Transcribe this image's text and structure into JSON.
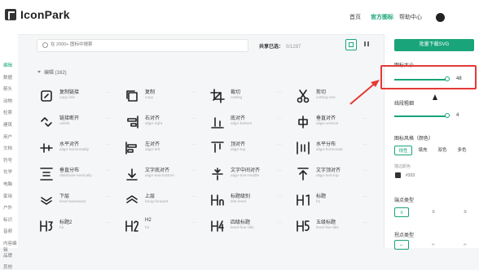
{
  "header": {
    "logo_text": "IconPark",
    "nav": [
      "首页",
      "官方图标",
      "帮助中心"
    ],
    "active_nav": "官方图标",
    "accent": "#19a47a"
  },
  "left_nav": {
    "items": [
      "编辑",
      "数据",
      "箭头",
      "动物",
      "检索",
      "建筑",
      "用户",
      "文档",
      "符号",
      "化学",
      "电脑",
      "家用",
      "户外",
      "标识",
      "音频",
      "内容编辑",
      "品牌",
      "其他"
    ],
    "active": "编辑"
  },
  "toolbar": {
    "search_placeholder": "在 2000+ 图标中搜索",
    "share_label": "共享已选：",
    "share_count": "0/1287"
  },
  "section": {
    "title": "编辑 (162)"
  },
  "icons": [
    {
      "name": "复制链接",
      "en": "copy-link",
      "icon": "copy-link-icon"
    },
    {
      "name": "复制",
      "en": "copy",
      "icon": "copy-icon"
    },
    {
      "name": "裁切",
      "en": "cutting",
      "icon": "crop-icon"
    },
    {
      "name": "剪切",
      "en": "cutting-one",
      "icon": "scissors-icon"
    },
    {
      "name": "链接断开",
      "en": "unlink",
      "icon": "unlink-icon"
    },
    {
      "name": "右对齐",
      "en": "align-right",
      "icon": "align-right-icon"
    },
    {
      "name": "底对齐",
      "en": "align-bottom",
      "icon": "align-bottom-icon"
    },
    {
      "name": "垂直对齐",
      "en": "align-vertical",
      "icon": "align-vertical-icon"
    },
    {
      "name": "水平对齐",
      "en": "align-horizontally",
      "icon": "align-horizontal-icon"
    },
    {
      "name": "左对齐",
      "en": "align-left",
      "icon": "align-left-icon"
    },
    {
      "name": "顶对齐",
      "en": "align-top",
      "icon": "align-top-icon"
    },
    {
      "name": "水平分布",
      "en": "align-horizontal",
      "icon": "distribute-horizontal-icon"
    },
    {
      "name": "垂直分布",
      "en": "distribute-vertically",
      "icon": "distribute-vertical-icon"
    },
    {
      "name": "文字底对齐",
      "en": "align-text-bottom",
      "icon": "text-bottom-icon"
    },
    {
      "name": "文字中间对齐",
      "en": "align-text-middle",
      "icon": "text-middle-icon"
    },
    {
      "name": "文字顶对齐",
      "en": "align-text-top",
      "icon": "text-top-icon"
    },
    {
      "name": "下层",
      "en": "level-backward",
      "icon": "send-backward-icon"
    },
    {
      "name": "上层",
      "en": "bring-forward",
      "icon": "bring-forward-icon"
    },
    {
      "name": "标题级别",
      "en": "title-level",
      "icon": "heading-level-icon"
    },
    {
      "name": "标题",
      "en": "h1",
      "icon": "h1-icon"
    },
    {
      "name": "标题2",
      "en": "h2",
      "icon": "h3-icon"
    },
    {
      "name": "H2",
      "en": "h2",
      "icon": "h2-icon"
    },
    {
      "name": "四级标题",
      "en": "level-four-title",
      "icon": "h4-icon"
    },
    {
      "name": "五级标题",
      "en": "level-five-title",
      "icon": "h5-icon"
    }
  ],
  "panel": {
    "download_label": "批量下载SVG",
    "size_label": "图标大小",
    "size_value": "48",
    "size_fraction": 1.0,
    "stroke_label": "线段粗细",
    "stroke_value": "4",
    "stroke_fraction": 1.0,
    "style_label": "图标风格（颜色）",
    "style_tabs": [
      "线性",
      "填充",
      "双色",
      "多色"
    ],
    "active_style": "线性",
    "color_label": "描边颜色",
    "color_hex": "#333",
    "endpoint_label": "端点类型",
    "corner_label": "拐点类型",
    "highlight_color": "#e53935"
  }
}
